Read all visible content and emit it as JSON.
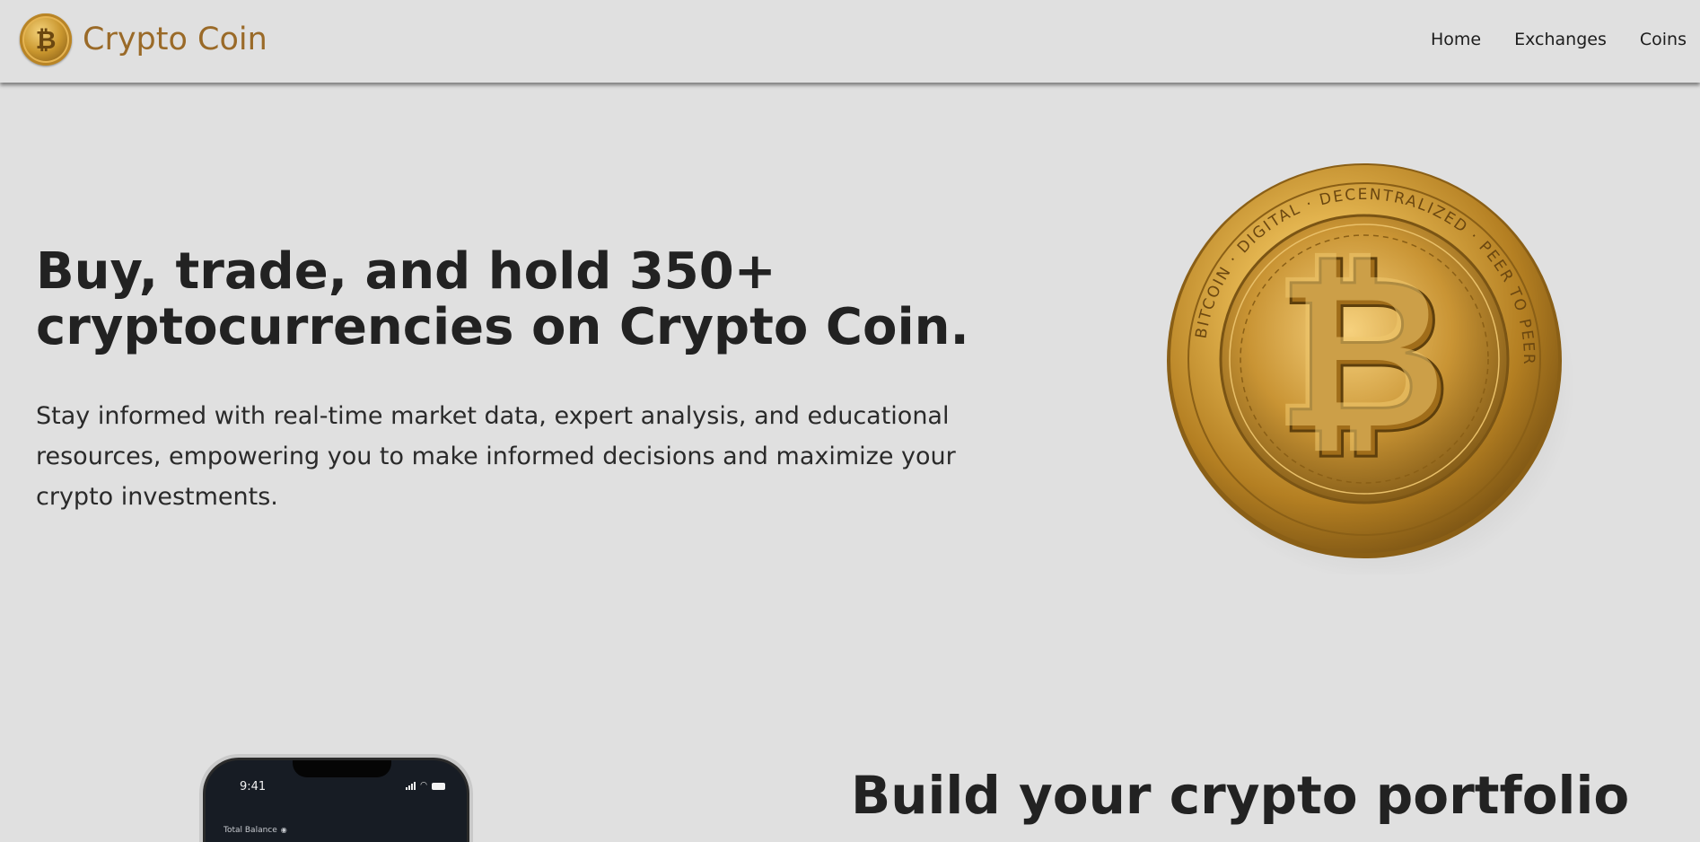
{
  "header": {
    "brand_name": "Crypto Coin",
    "logo_icon": "bitcoin-coin-logo",
    "logo_symbol": "₿",
    "nav": [
      {
        "label": "Home"
      },
      {
        "label": "Exchanges"
      },
      {
        "label": "Coins"
      }
    ]
  },
  "hero": {
    "title_line1": "Buy, trade, and hold 350+",
    "title_line2": "cryptocurrencies on Crypto Coin.",
    "desc_line1": "Stay informed with real-time market data, expert analysis, and educational",
    "desc_line2": "resources, empowering you to make informed decisions and maximize your",
    "desc_line3": "crypto investments.",
    "image": "gold-bitcoin-coin-image",
    "coin_ring_text": "BITCOIN · DIGITAL · DECENTRALIZED · PEER TO PEER"
  },
  "portfolio_section": {
    "title": "Build your crypto portfolio",
    "phone": {
      "time": "9:41",
      "balance_label": "Total Balance"
    }
  },
  "colors": {
    "background": "#e0e0e0",
    "brand": "#9a6a28",
    "text": "#222222",
    "gold": "#d4a440"
  }
}
